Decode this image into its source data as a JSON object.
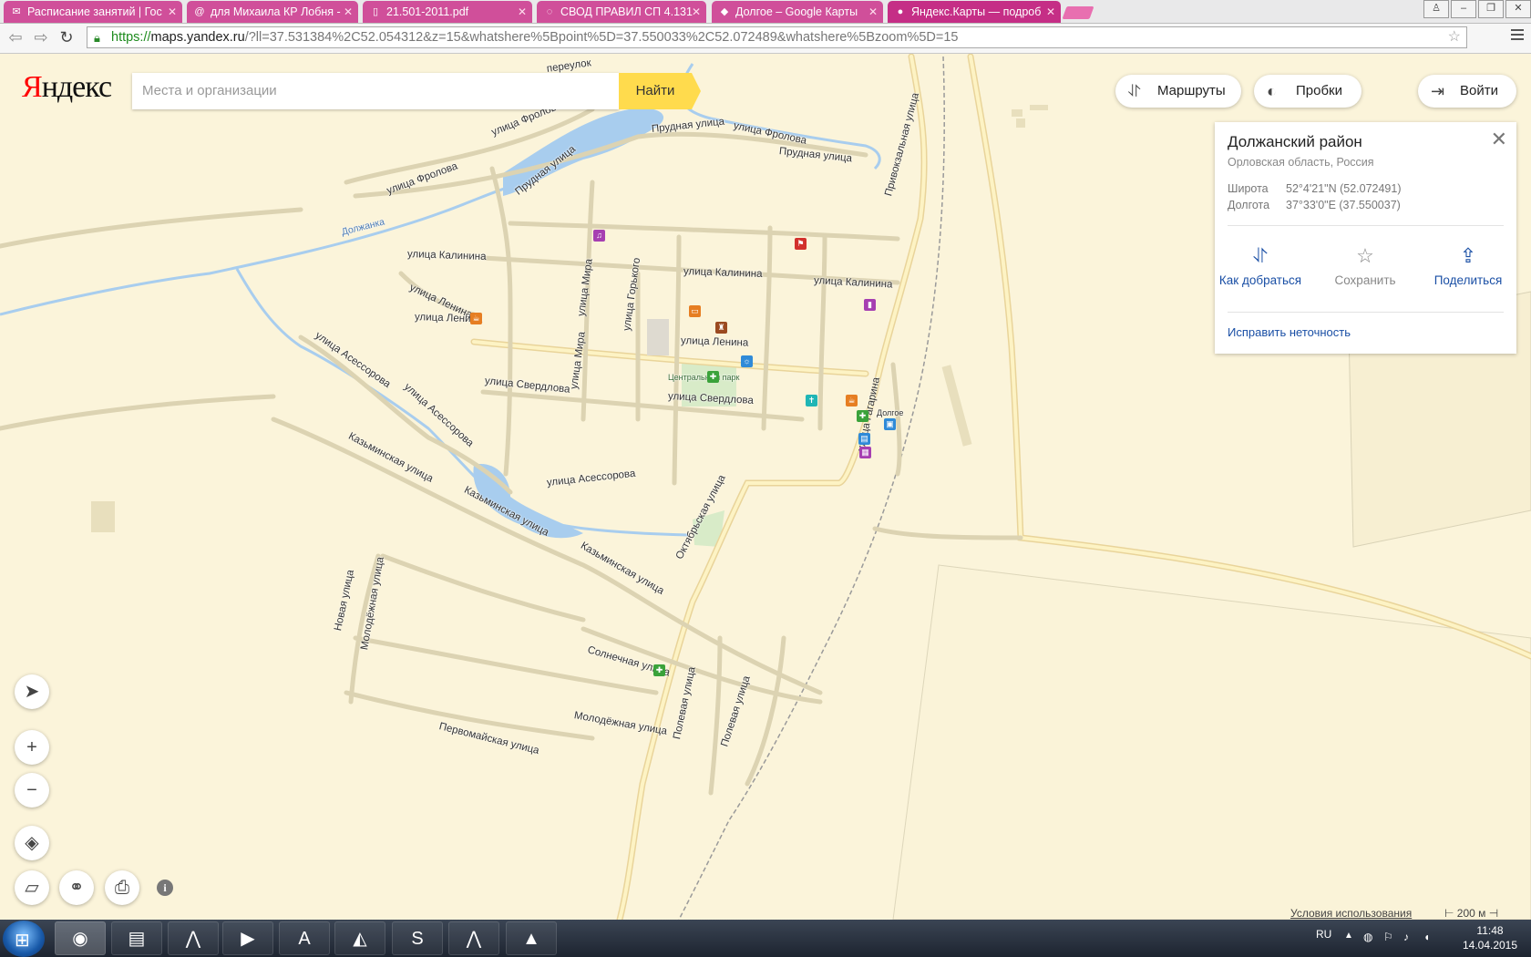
{
  "browser": {
    "tabs": [
      {
        "label": "Расписание занятий | Гос",
        "icon": "yandex-mail-icon"
      },
      {
        "label": "для Михаила КР Лобня -",
        "icon": "mail-at-icon"
      },
      {
        "label": "21.501-2011.pdf",
        "icon": "document-icon"
      },
      {
        "label": "СВОД ПРАВИЛ СП 4.131",
        "icon": "loading-icon"
      },
      {
        "label": "Долгое – Google Карты",
        "icon": "google-maps-icon"
      },
      {
        "label": "Яндекс.Карты — подроб",
        "icon": "yandex-maps-pin-icon"
      }
    ],
    "url_scheme": "https://",
    "url_host": "maps.yandex.ru",
    "url_rest": "/?ll=37.531384%2C52.054312&z=15&whatshere%5Bpoint%5D=37.550033%2C52.072489&whatshere%5Bzoom%5D=15"
  },
  "header": {
    "logo_first": "Я",
    "logo_rest": "ндекс",
    "search_placeholder": "Места и организации",
    "find_label": "Найти",
    "routes_label": "Маршруты",
    "traffic_label": "Пробки",
    "login_label": "Войти"
  },
  "card": {
    "title": "Должанский район",
    "subtitle": "Орловская область, Россия",
    "lat_label": "Широта",
    "lat_value": "52°4'21\"N (52.072491)",
    "lon_label": "Долгота",
    "lon_value": "37°33'0\"E (37.550037)",
    "action_route": "Как добраться",
    "action_save": "Сохранить",
    "action_share": "Поделиться",
    "fix_link": "Исправить неточность"
  },
  "map": {
    "labels": [
      {
        "text": "переулок"
      },
      {
        "text": "улица Фролова"
      },
      {
        "text": "улица Фролова"
      },
      {
        "text": "улица Фролова"
      },
      {
        "text": "Прудная улица"
      },
      {
        "text": "Прудная улица"
      },
      {
        "text": "Прудная улица"
      },
      {
        "text": "Привокзальная улица"
      },
      {
        "text": "Должанка"
      },
      {
        "text": "улица Калинина"
      },
      {
        "text": "улица Калинина"
      },
      {
        "text": "улица Калинина"
      },
      {
        "text": "улица Ленина"
      },
      {
        "text": "улица Ленина"
      },
      {
        "text": "улица Ленина"
      },
      {
        "text": "улица Мира"
      },
      {
        "text": "улица Мира"
      },
      {
        "text": "улица Горького"
      },
      {
        "text": "улица Свердлова"
      },
      {
        "text": "улица Свердлова"
      },
      {
        "text": "улица Асессорова"
      },
      {
        "text": "улица Асессорова"
      },
      {
        "text": "улица Асессорова"
      },
      {
        "text": "Центральный парк"
      },
      {
        "text": "Долгое"
      },
      {
        "text": "улица Гагарина"
      },
      {
        "text": "Казьминская улица"
      },
      {
        "text": "Казьминская улица"
      },
      {
        "text": "Казьминская улица"
      },
      {
        "text": "Октябрьская улица"
      },
      {
        "text": "Новая улица"
      },
      {
        "text": "Молодёжная улица"
      },
      {
        "text": "Молодёжная улица"
      },
      {
        "text": "Солнечная улица"
      },
      {
        "text": "Первомайская улица"
      },
      {
        "text": "Полевая улица"
      },
      {
        "text": "Полевая улица"
      }
    ],
    "terms_link": "Условия использования",
    "scale": "200 м"
  },
  "taskbar": {
    "lang": "RU",
    "time": "11:48",
    "date": "14.04.2015"
  }
}
